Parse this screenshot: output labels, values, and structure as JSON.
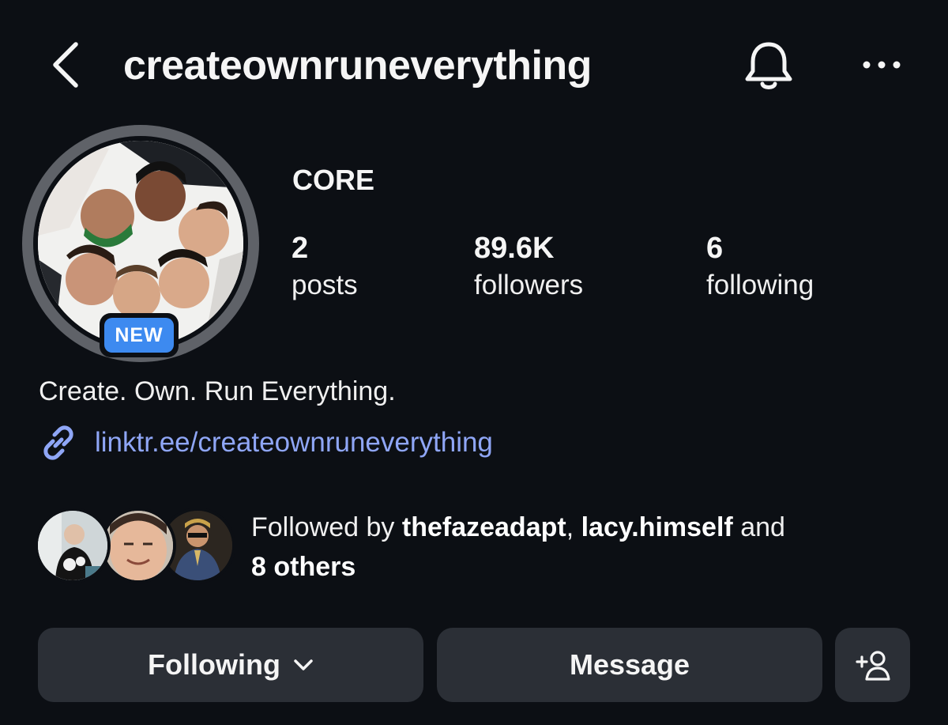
{
  "header": {
    "username": "createownruneverything",
    "icons": {
      "back": "chevron-left-icon",
      "notifications": "bell-icon",
      "more": "more-horizontal-icon"
    }
  },
  "profile": {
    "display_name": "CORE",
    "badge": "NEW",
    "stats": {
      "posts": {
        "value": "2",
        "label": "posts"
      },
      "followers": {
        "value": "89.6K",
        "label": "followers"
      },
      "following": {
        "value": "6",
        "label": "following"
      }
    },
    "bio": "Create. Own. Run Everything.",
    "link": "linktr.ee/createownruneverything"
  },
  "followed_by": {
    "prefix": "Followed by",
    "user1": "thefazeadapt",
    "separator": ",",
    "user2": "lacy.himself",
    "conjunction": "and",
    "others": "8 others"
  },
  "actions": {
    "following_label": "Following",
    "message_label": "Message"
  },
  "colors": {
    "background": "#0c0f14",
    "button": "#2b2f36",
    "badge": "#3d8af0",
    "link": "#8fa6f6"
  }
}
